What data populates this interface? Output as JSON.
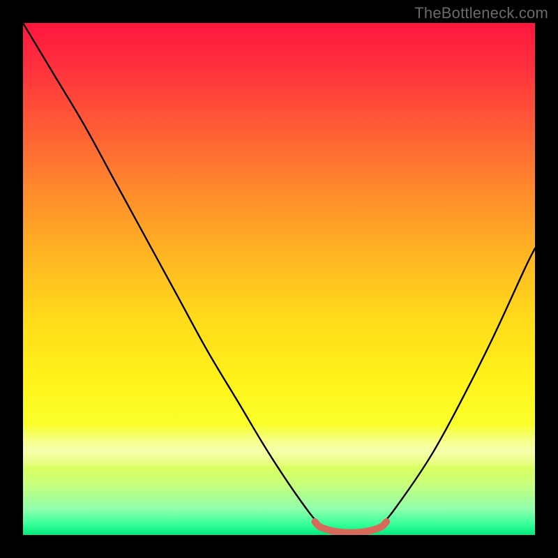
{
  "watermark": "TheBottleneck.com",
  "chart_data": {
    "type": "line",
    "title": "",
    "xlabel": "",
    "ylabel": "",
    "xlim": [
      0,
      100
    ],
    "ylim": [
      0,
      100
    ],
    "grid": false,
    "series": [
      {
        "name": "bottleneck-curve",
        "x": [
          0,
          6,
          12,
          18,
          24,
          30,
          36,
          42,
          48,
          54,
          58,
          61,
          64,
          67,
          70,
          74,
          80,
          86,
          92,
          98,
          100
        ],
        "y": [
          100,
          90,
          80,
          69,
          58,
          47,
          36,
          26,
          16,
          7,
          2,
          0.5,
          0.3,
          0.5,
          2,
          7,
          16,
          27,
          39,
          52,
          56
        ]
      },
      {
        "name": "optimal-range-marker",
        "color": "#d86a5c",
        "x": [
          57,
          58,
          60,
          62,
          64,
          66,
          68,
          70,
          71
        ],
        "y": [
          2.6,
          1.6,
          0.9,
          0.55,
          0.45,
          0.55,
          0.9,
          1.6,
          2.6
        ]
      }
    ]
  }
}
